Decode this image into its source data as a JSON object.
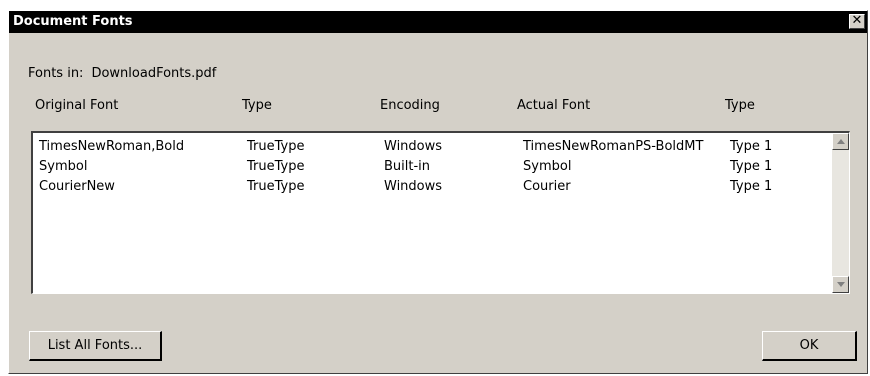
{
  "window": {
    "title": "Document Fonts",
    "close_glyph": "✕"
  },
  "fonts_in": {
    "label": "Fonts in:",
    "filename": "DownloadFonts.pdf"
  },
  "columns": [
    "Original Font",
    "Type",
    "Encoding",
    "Actual Font",
    "Type"
  ],
  "rows": [
    [
      "TimesNewRoman,Bold",
      "TrueType",
      "Windows",
      "TimesNewRomanPS-BoldMT",
      "Type 1"
    ],
    [
      "Symbol",
      "TrueType",
      "Built-in",
      "Symbol",
      "Type 1"
    ],
    [
      "CourierNew",
      "TrueType",
      "Windows",
      "Courier",
      "Type 1"
    ]
  ],
  "buttons": {
    "list_all": "List All Fonts...",
    "ok": "OK"
  },
  "icons": {
    "close": "close-icon",
    "scroll_up": "scroll-up-arrow-icon",
    "scroll_down": "scroll-down-arrow-icon"
  }
}
